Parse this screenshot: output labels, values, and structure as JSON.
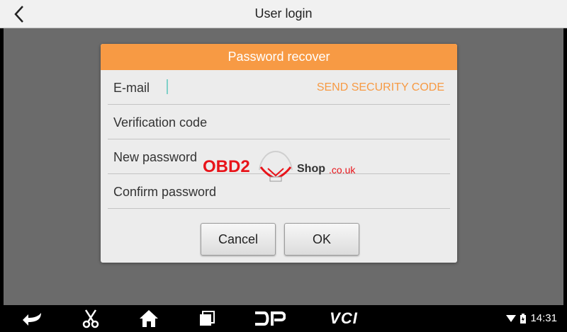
{
  "topbar": {
    "title": "User login",
    "back_icon": "chevron-left-icon"
  },
  "dialog": {
    "title": "Password recover",
    "email_label": "E-mail",
    "send_code_label": "SEND SECURITY CODE",
    "verification_label": "Verification code",
    "new_password_label": "New password",
    "confirm_password_label": "Confirm password",
    "cancel_label": "Cancel",
    "ok_label": "OK",
    "accent_color": "#f79a44"
  },
  "watermark": {
    "brand": "OBD2",
    "shop": "Shop",
    "domain": ".co.uk"
  },
  "navbar": {
    "icons": [
      "back-arrow-icon",
      "scissors-icon",
      "home-icon",
      "recent-apps-icon",
      "dp-icon",
      "vci-icon"
    ],
    "vci_label": "VCI",
    "time": "14:31"
  }
}
